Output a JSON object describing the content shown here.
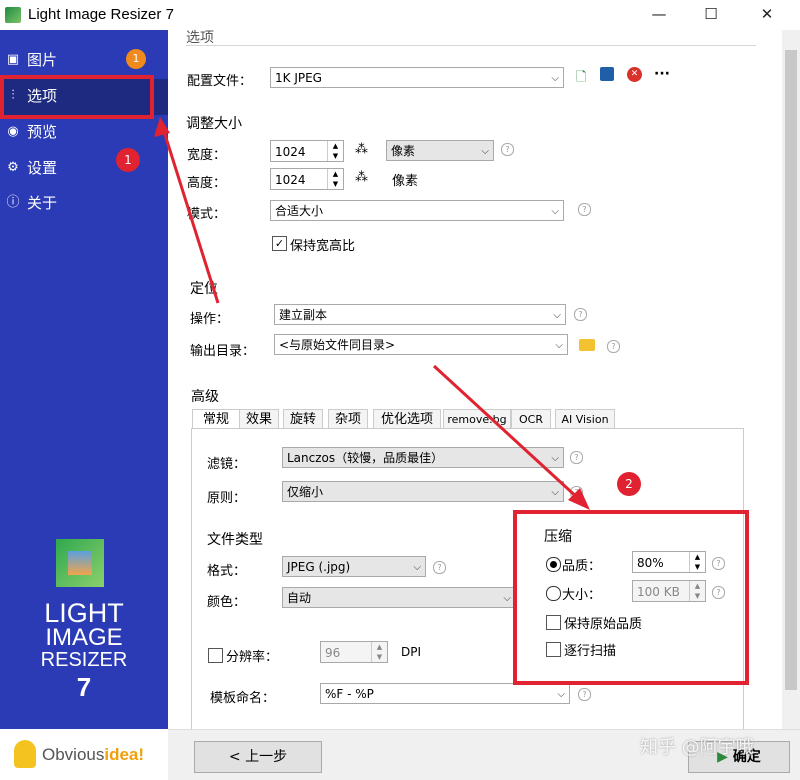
{
  "window": {
    "title": "Light Image Resizer 7",
    "min": "—",
    "max": "☐",
    "close": "✕"
  },
  "sidebar": {
    "items": [
      {
        "label": "图片",
        "icon": "images-icon"
      },
      {
        "label": "选项",
        "icon": "sliders-icon"
      },
      {
        "label": "预览",
        "icon": "eye-icon"
      },
      {
        "label": "设置",
        "icon": "gear-icon"
      },
      {
        "label": "关于",
        "icon": "info-icon"
      }
    ],
    "badge": "1",
    "logo": {
      "line1": "LIGHT",
      "line2": "IMAGE",
      "line3": "RESIZER",
      "line4": "7"
    },
    "brand": {
      "part1": "Obvious",
      "part2": "idea!"
    }
  },
  "main": {
    "section_options": "选项",
    "profile": {
      "label": "配置文件：",
      "value": "1K JPEG"
    },
    "resize": {
      "title": "调整大小",
      "width_label": "宽度：",
      "width_value": "1024",
      "height_label": "高度：",
      "height_value": "1024",
      "unit_value": "像素",
      "unit_text": "像素",
      "mode_label": "模式：",
      "mode_value": "合适大小",
      "keep_ratio": "保持宽高比"
    },
    "target": {
      "title": "定位",
      "action_label": "操作：",
      "action_value": "建立副本",
      "output_label": "输出目录：",
      "output_value": "<与原始文件同目录>"
    },
    "advanced": {
      "title": "高级",
      "tabs": [
        "常规",
        "效果",
        "旋转",
        "杂项",
        "优化选项",
        "remove.bg",
        "OCR",
        "AI Vision"
      ],
      "filter_label": "滤镜：",
      "filter_value": "Lanczos（较慢，品质最佳）",
      "rule_label": "原则：",
      "rule_value": "仅缩小",
      "filetype_title": "文件类型",
      "format_label": "格式：",
      "format_value": "JPEG (.jpg)",
      "color_label": "颜色：",
      "color_value": "自动",
      "resolution_label": "分辨率：",
      "resolution_value": "96",
      "resolution_unit": "DPI",
      "naming_label": "模板命名：",
      "naming_value": "%F - %P"
    },
    "compression": {
      "title": "压缩",
      "quality_label": "品质：",
      "quality_value": "80%",
      "size_label": "大小：",
      "size_value": "100 KB",
      "keep_quality": "保持原始品质",
      "progressive": "逐行扫描"
    }
  },
  "footer": {
    "back": "< 上一步",
    "ok": "确定",
    "watermark": "知乎 @阿宇哦"
  },
  "annotations": {
    "marker1": "1",
    "marker2": "2"
  },
  "colors": {
    "sidebar": "#2a3bb5",
    "selected": "#1d2a80",
    "annotation_red": "#e02231",
    "badge": "#f08a1c"
  }
}
